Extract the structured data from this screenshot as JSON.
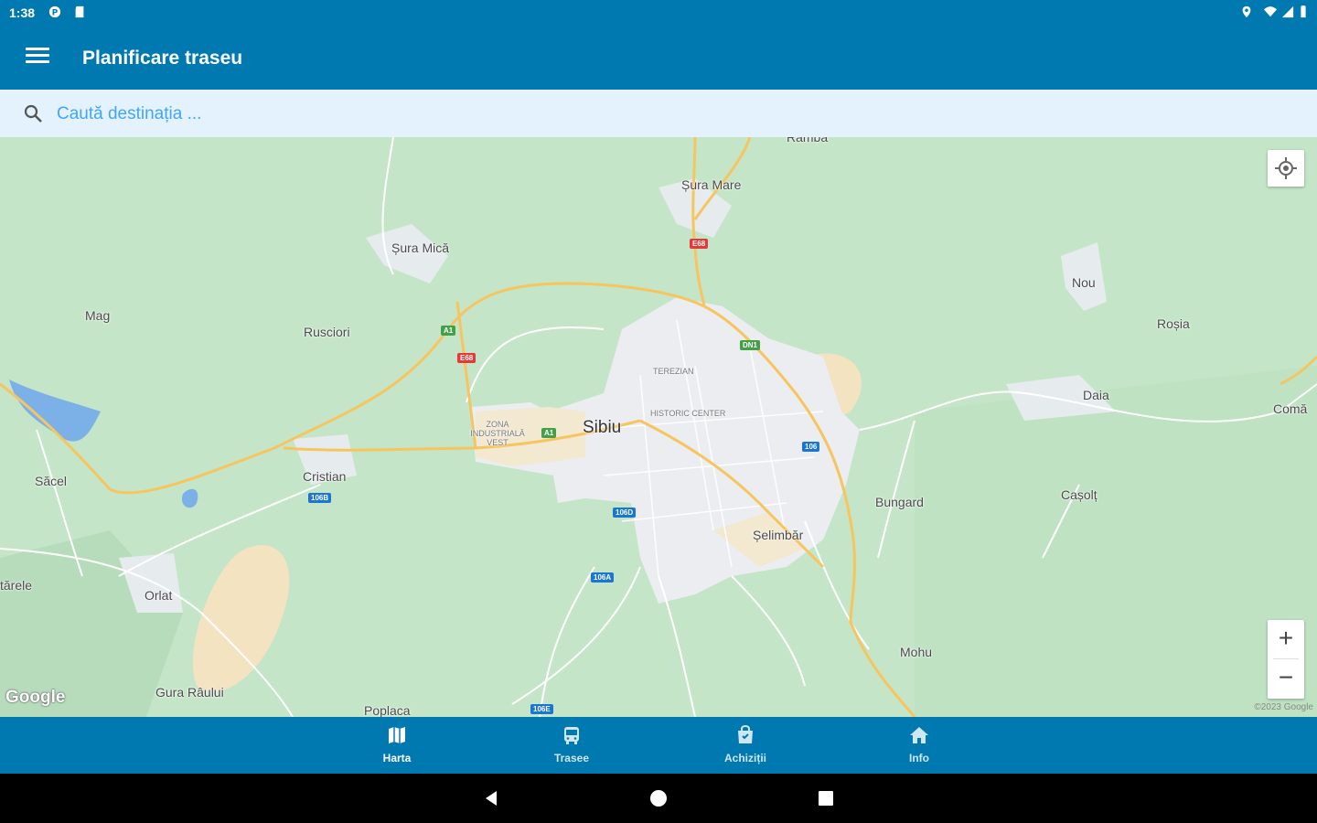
{
  "status_bar": {
    "time": "1:38"
  },
  "app_bar": {
    "title": "Planificare traseu",
    "menu_icon": "menu-icon"
  },
  "search": {
    "placeholder": "Caută destinația ..."
  },
  "map": {
    "labels": {
      "ramba": "Rambă",
      "sura_mare": "Șura Mare",
      "sura_mica": "Șura Mică",
      "nou": "Nou",
      "mag": "Mag",
      "rusciori": "Rusciori",
      "rosia": "Roșia",
      "daia": "Daia",
      "sibiu": "Sibiu",
      "comana": "Comă",
      "saccel": "Săcel",
      "cristian": "Cristian",
      "bungard": "Bungard",
      "casolt": "Cașolț",
      "selimbar": "Șelimbăr",
      "tarele": "tărele",
      "orlat": "Orlat",
      "mohu": "Mohu",
      "gura_raului": "Gura Râului",
      "poplaca": "Poplaca",
      "terezian": "TEREZIAN",
      "historic_center": "HISTORIC CENTER",
      "zona_industriala": "ZONA INDUSTRIALĂ VEST"
    },
    "shields": {
      "e68_north": "E68",
      "a1": "A1",
      "e68_west": "E68",
      "dn1": "DN1",
      "a1_east": "A1",
      "r106": "106",
      "r106b": "106B",
      "r106d": "106D",
      "r106a": "106A",
      "r106e": "106E"
    },
    "google_logo": "Google",
    "copyright": "©2023 Google",
    "zoom_in": "+",
    "zoom_out": "−"
  },
  "bottom_nav": {
    "items": [
      {
        "label": "Harta",
        "icon": "map-icon"
      },
      {
        "label": "Trasee",
        "icon": "bus-icon"
      },
      {
        "label": "Achiziții",
        "icon": "shopping-bag-icon"
      },
      {
        "label": "Info",
        "icon": "home-icon"
      }
    ],
    "active_index": 0
  },
  "colors": {
    "primary": "#0078b0",
    "search_bg": "#e3f2fd",
    "map_green": "#c8e6c9",
    "urban": "#eceff1",
    "road_yellow": "#f6c560"
  }
}
